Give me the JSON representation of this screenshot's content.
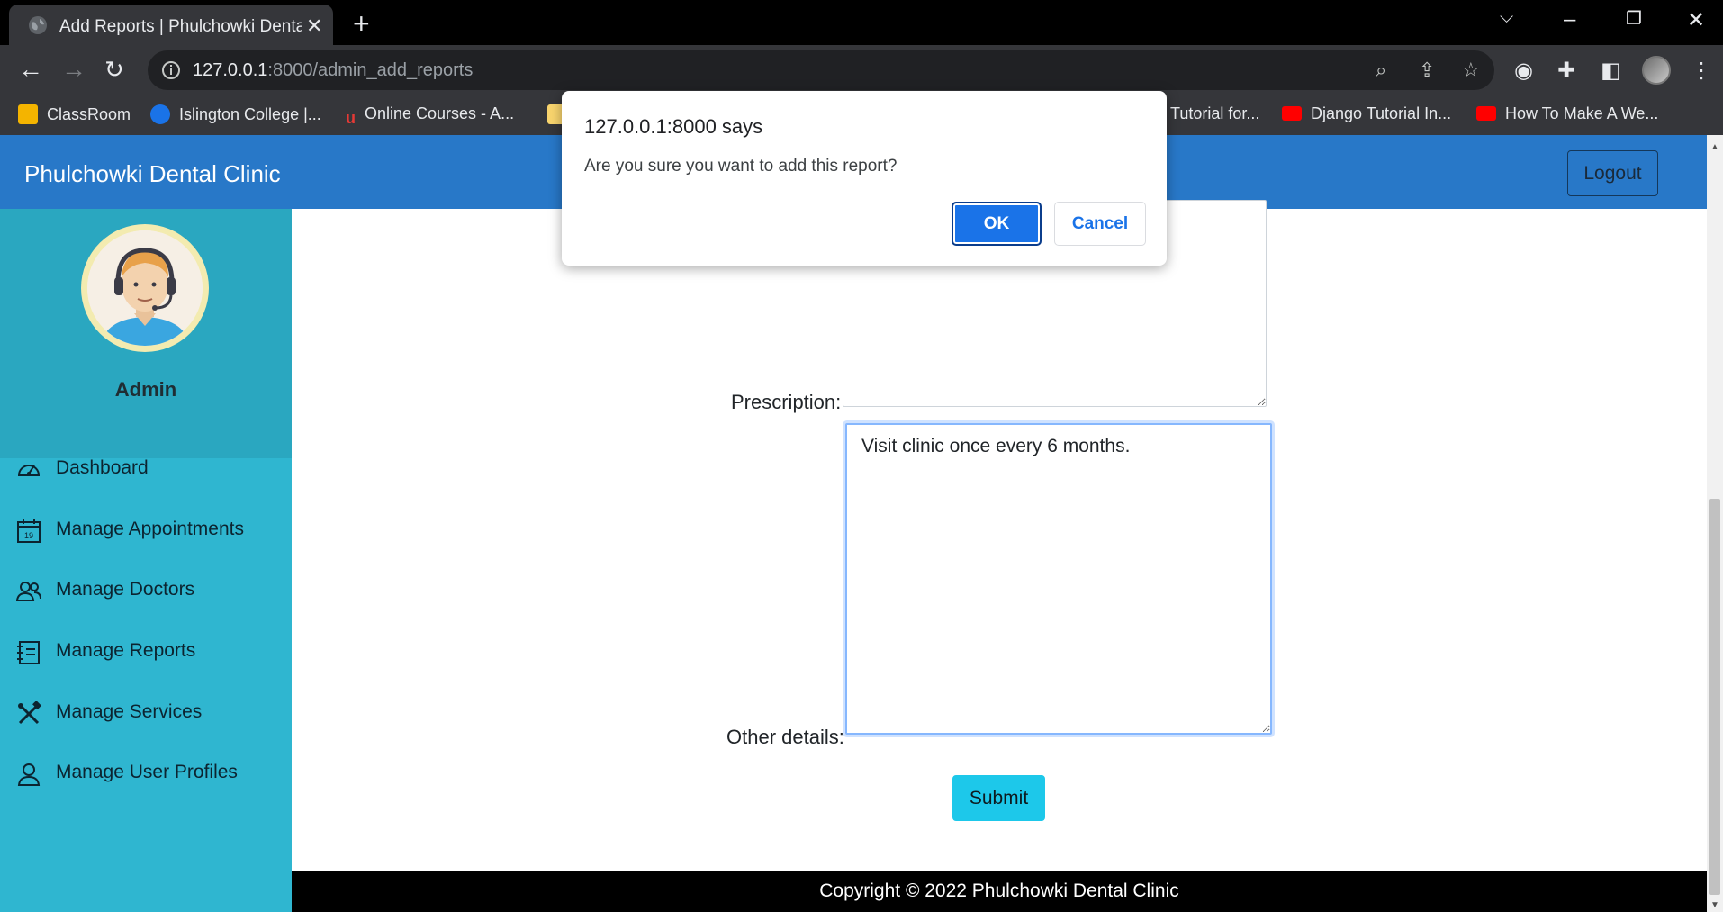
{
  "browser": {
    "tab_title": "Add Reports | Phulchowki Dental",
    "url_host": "127.0.0.1",
    "url_rest": ":8000/admin_add_reports",
    "bookmarks": [
      {
        "label": "ClassRoom",
        "color": "#f4b400"
      },
      {
        "label": "Islington College |...",
        "color": "#1a73e8"
      },
      {
        "label": "Online Courses - A...",
        "color": "#e53935"
      },
      {
        "label": "Tutorial for...",
        "color": "#f4b400"
      },
      {
        "label": "Django Tutorial In...",
        "color": "#ff0000"
      },
      {
        "label": "How To Make A We...",
        "color": "#ff0000"
      }
    ]
  },
  "header": {
    "brand": "Phulchowki Dental Clinic",
    "logout_label": "Logout",
    "color": "#2878c8"
  },
  "sidebar": {
    "username": "Admin",
    "items": [
      {
        "label": "Dashboard",
        "icon": "dashboard-gauge-icon"
      },
      {
        "label": "Manage Appointments",
        "icon": "calendar-icon"
      },
      {
        "label": "Manage Doctors",
        "icon": "people-icon"
      },
      {
        "label": "Manage Reports",
        "icon": "journal-icon"
      },
      {
        "label": "Manage Services",
        "icon": "tools-icon"
      },
      {
        "label": "Manage User Profiles",
        "icon": "person-icon"
      }
    ],
    "calendar_day": "19"
  },
  "form": {
    "prescription_label": "Prescription:",
    "prescription_value": "",
    "other_details_label": "Other details:",
    "other_details_value": "Visit clinic once every 6 months.",
    "submit_label": "Submit"
  },
  "footer": {
    "text": "Copyright © 2022 Phulchowki Dental Clinic"
  },
  "dialog": {
    "title": "127.0.0.1:8000 says",
    "message": "Are you sure you want to add this report?",
    "ok_label": "OK",
    "cancel_label": "Cancel"
  }
}
